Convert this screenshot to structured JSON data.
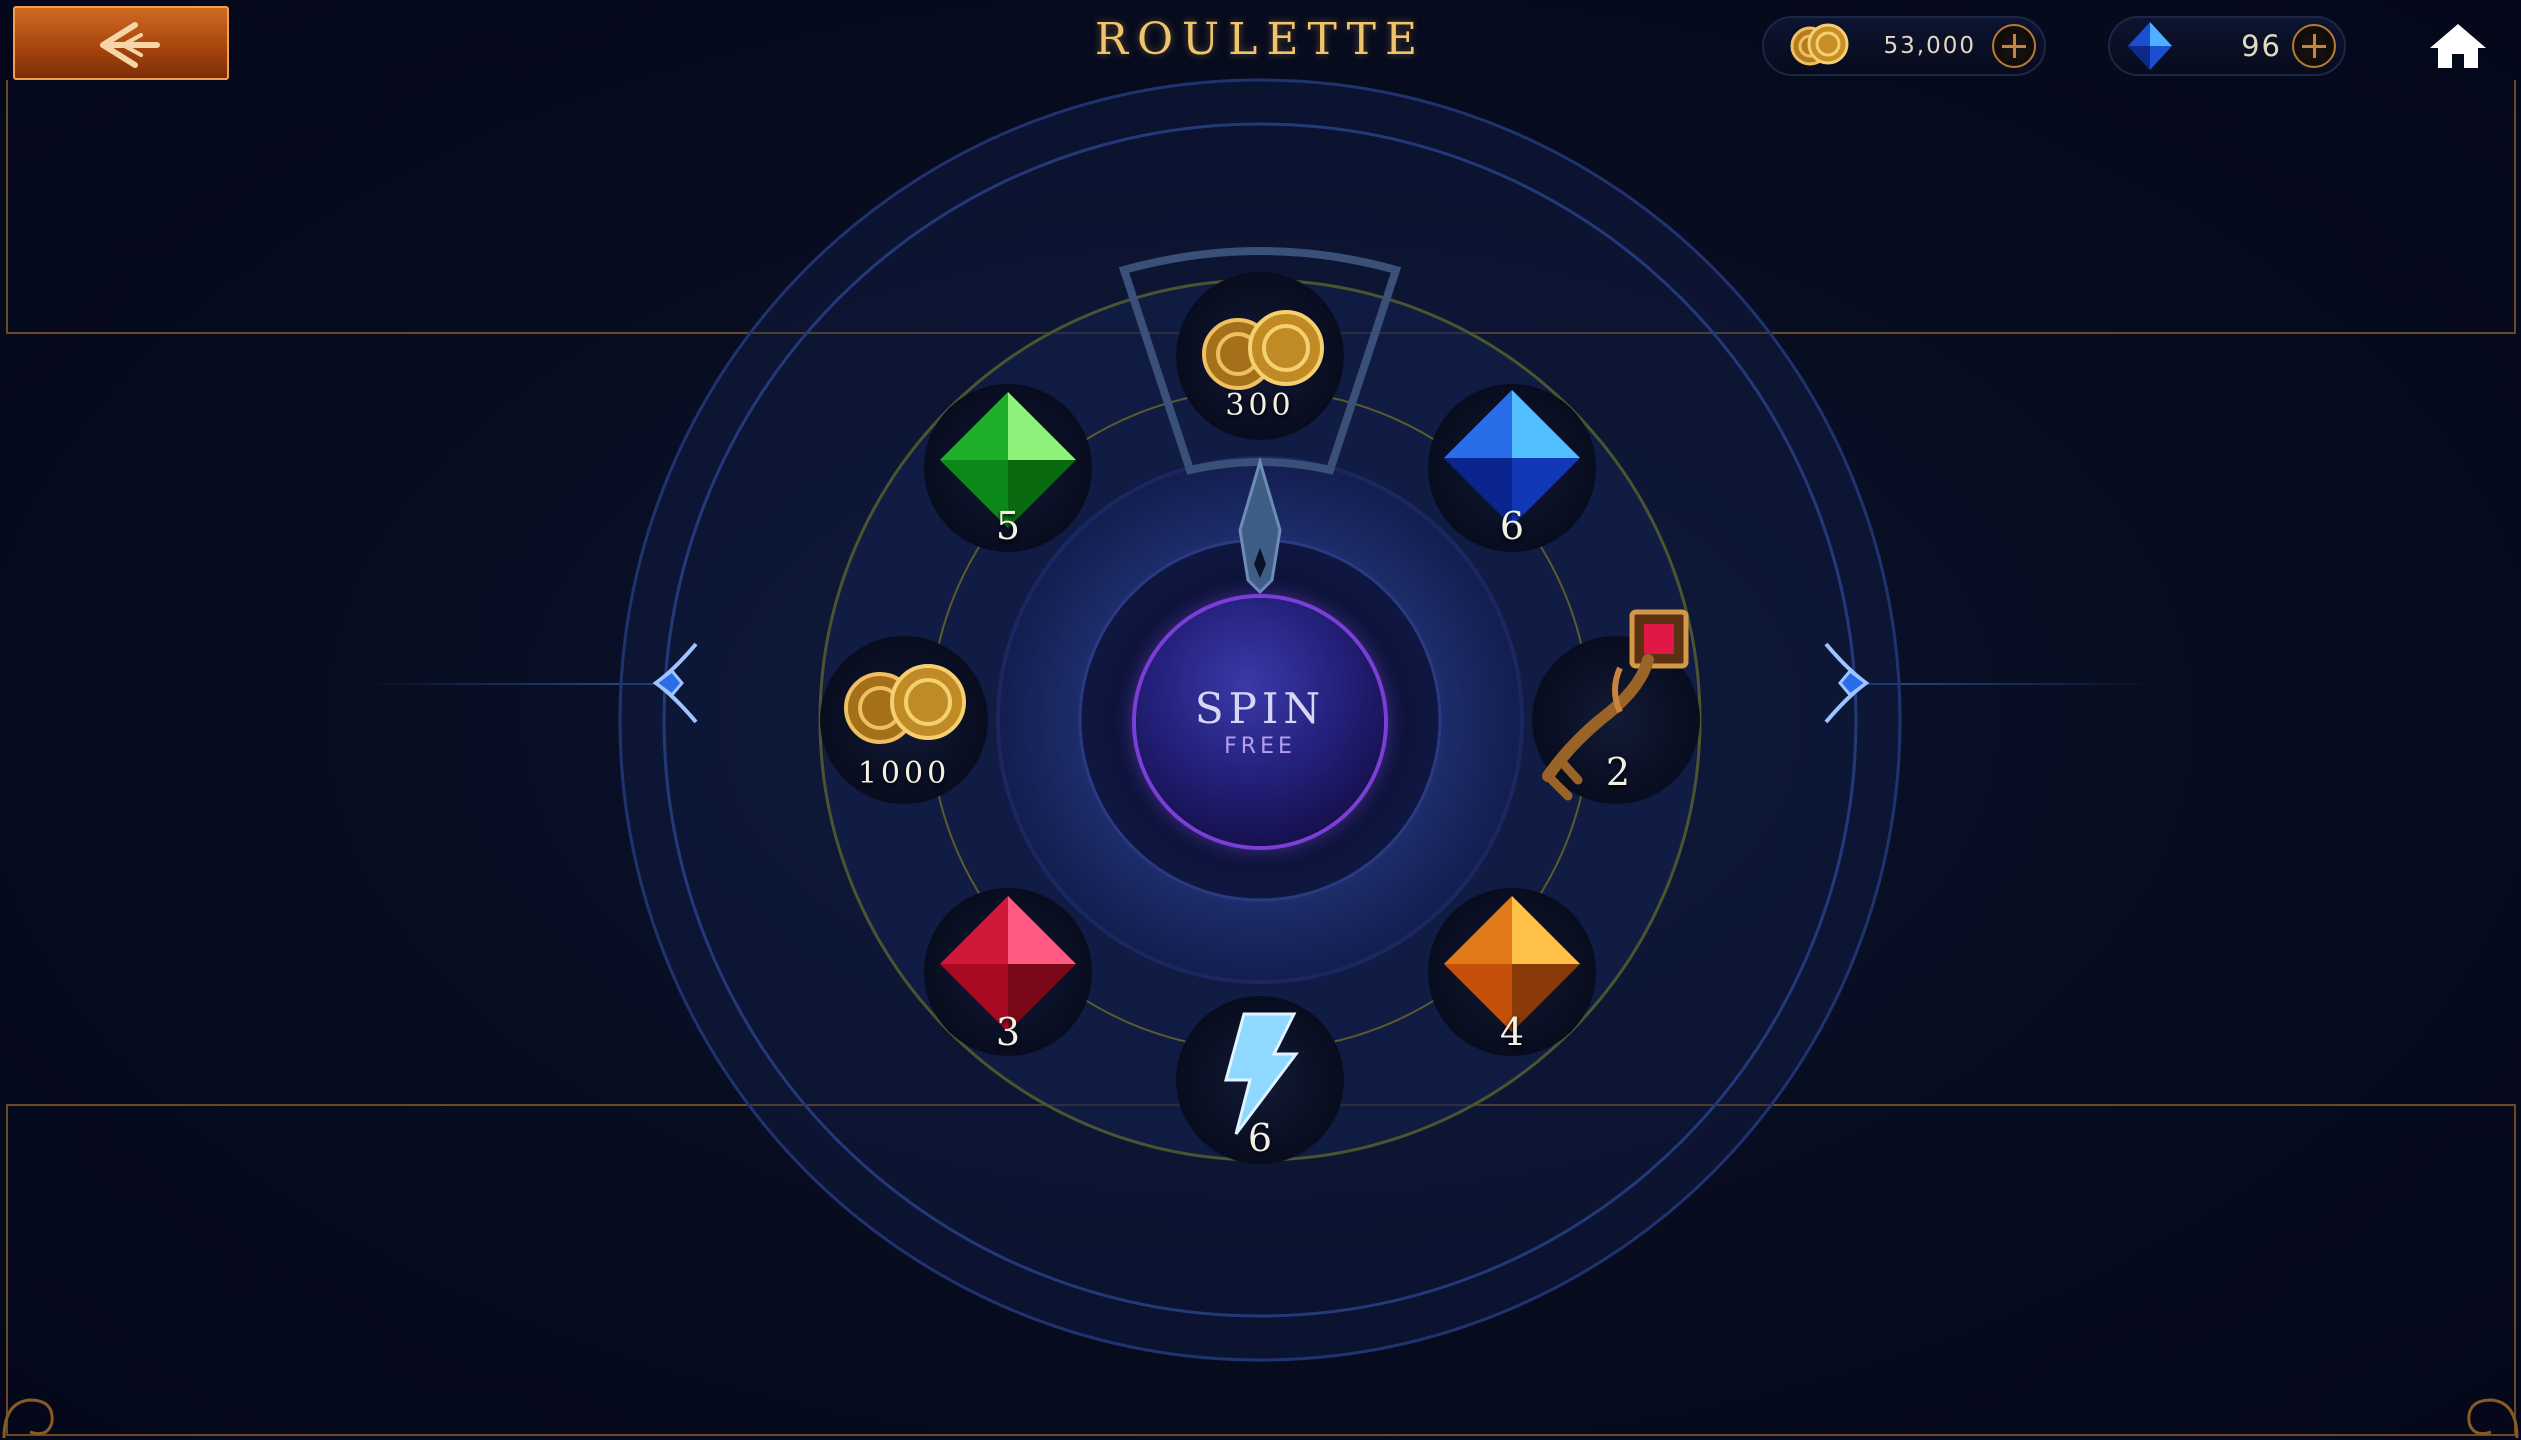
{
  "header": {
    "title": "ROULETTE",
    "coins": {
      "value": "53,000",
      "icon": "coins-icon"
    },
    "gems": {
      "value": "96",
      "icon": "blue-gem-icon"
    },
    "back_icon": "back-arrow-icon",
    "home_icon": "home-icon"
  },
  "wheel": {
    "spin_label": "SPIN",
    "spin_sublabel": "FREE",
    "pointer_icon": "pointer-icon",
    "rewards": [
      {
        "icon": "coins-icon",
        "amount": "300"
      },
      {
        "icon": "blue-gem-icon",
        "amount": "6"
      },
      {
        "icon": "key-icon",
        "amount": "2"
      },
      {
        "icon": "orange-gem-icon",
        "amount": "4"
      },
      {
        "icon": "lightning-icon",
        "amount": "6"
      },
      {
        "icon": "red-gem-icon",
        "amount": "3"
      },
      {
        "icon": "coins-icon",
        "amount": "1000"
      },
      {
        "icon": "green-gem-icon",
        "amount": "5"
      }
    ]
  },
  "colors": {
    "accent_gold": "#f0c46a",
    "back_button": "#c0581a",
    "spin_ring": "#7b3ed6",
    "background": "#070c1f"
  }
}
